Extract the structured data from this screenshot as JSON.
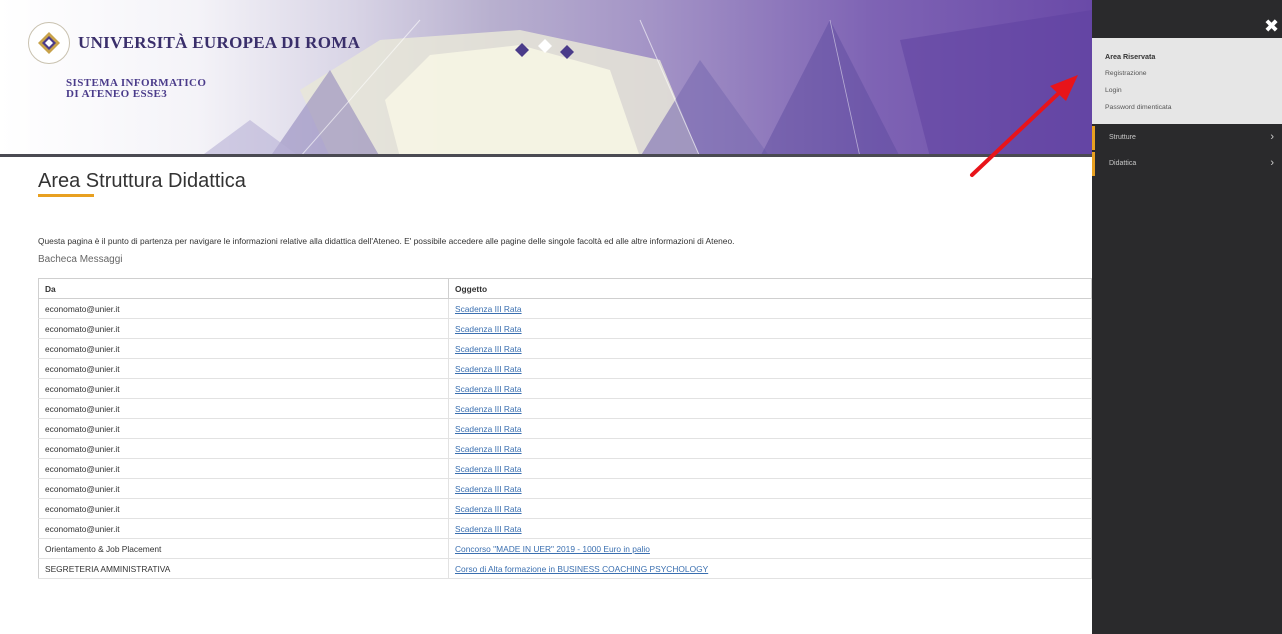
{
  "header": {
    "university_name": "UNIVERSITÀ EUROPEA DI ROMA",
    "subtitle_line1": "SISTEMA INFORMATICO",
    "subtitle_line2": "DI ATENEO ESSE3"
  },
  "main": {
    "title": "Area Struttura Didattica",
    "intro": "Questa pagina è il punto di partenza per navigare le informazioni relative alla didattica dell'Ateneo. E' possibile accedere alle pagine delle singole facoltà ed alle altre informazioni di Ateneo.",
    "section_title": "Bacheca Messaggi",
    "table": {
      "headers": [
        "Da",
        "Oggetto"
      ],
      "rows": [
        {
          "da": "economato@unier.it",
          "oggetto": "Scadenza III Rata"
        },
        {
          "da": "economato@unier.it",
          "oggetto": "Scadenza III Rata"
        },
        {
          "da": "economato@unier.it",
          "oggetto": "Scadenza III Rata"
        },
        {
          "da": "economato@unier.it",
          "oggetto": "Scadenza III Rata"
        },
        {
          "da": "economato@unier.it",
          "oggetto": "Scadenza III Rata"
        },
        {
          "da": "economato@unier.it",
          "oggetto": "Scadenza III Rata"
        },
        {
          "da": "economato@unier.it",
          "oggetto": "Scadenza III Rata"
        },
        {
          "da": "economato@unier.it",
          "oggetto": "Scadenza III Rata"
        },
        {
          "da": "economato@unier.it",
          "oggetto": "Scadenza III Rata"
        },
        {
          "da": "economato@unier.it",
          "oggetto": "Scadenza III Rata"
        },
        {
          "da": "economato@unier.it",
          "oggetto": "Scadenza III Rata"
        },
        {
          "da": "economato@unier.it",
          "oggetto": "Scadenza III Rata"
        },
        {
          "da": "Orientamento & Job Placement",
          "oggetto": "Concorso \"MADE IN UER\" 2019 - 1000 Euro in palio"
        },
        {
          "da": "SEGRETERIA AMMINISTRATIVA",
          "oggetto": "Corso di Alta formazione in BUSINESS COACHING PSYCHOLOGY"
        }
      ]
    }
  },
  "sidepanel": {
    "close_icon": "close-icon",
    "reserved_area": {
      "title": "Area Riservata",
      "links": [
        "Registrazione",
        "Login",
        "Password dimenticata"
      ]
    },
    "menu": [
      {
        "label": "Strutture"
      },
      {
        "label": "Didattica"
      }
    ]
  },
  "colors": {
    "accent": "#e8a020",
    "link": "#3a6fb0",
    "panel_bg": "#2a2a2c",
    "arrow": "#e8141a"
  }
}
